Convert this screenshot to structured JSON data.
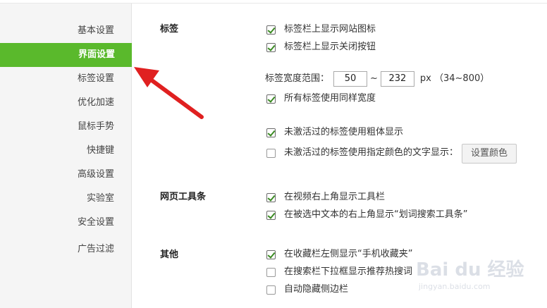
{
  "sidebar": {
    "items": [
      {
        "label": "基本设置"
      },
      {
        "label": "界面设置",
        "active": true
      },
      {
        "label": "标签设置"
      },
      {
        "label": "优化加速"
      },
      {
        "label": "鼠标手势"
      },
      {
        "label": "快捷键"
      },
      {
        "label": "高级设置"
      },
      {
        "label": "实验室"
      },
      {
        "label": "安全设置"
      },
      {
        "label": "广告过滤"
      }
    ]
  },
  "sections": {
    "tabs": {
      "title": "标签",
      "show_site_icon": {
        "label": "标签栏上显示网站图标",
        "checked": true
      },
      "show_close_button": {
        "label": "标签栏上显示关闭按钮",
        "checked": true
      },
      "width_range": {
        "label": "标签宽度范围：",
        "min": "50",
        "separator": "~",
        "max": "232",
        "unit": "px （34~800）"
      },
      "same_width": {
        "label": "所有标签使用同样宽度",
        "checked": true
      },
      "bold_inactive": {
        "label": "未激活过的标签使用粗体显示",
        "checked": true
      },
      "color_inactive": {
        "label": "未激活过的标签使用指定颜色的文字显示：",
        "checked": false
      },
      "set_color_button": "设置颜色"
    },
    "toolbar": {
      "title": "网页工具条",
      "video_toolbar": {
        "label": "在视频右上角显示工具栏",
        "checked": true
      },
      "selection_toolbar": {
        "label": "在被选中文本的右上角显示“划词搜索工具条”",
        "checked": true
      }
    },
    "other": {
      "title": "其他",
      "mobile_favorites": {
        "label": "在收藏栏左侧显示“手机收藏夹”",
        "checked": true
      },
      "search_suggestions": {
        "label": "在搜索栏下拉框显示推荐热搜词",
        "checked": false
      },
      "auto_hide_sidebar": {
        "label": "自动隐藏侧边栏",
        "checked": false
      }
    }
  },
  "watermark": {
    "main": "Bai du 经验",
    "sub": "jingyan.baidu.com"
  },
  "colors": {
    "accent": "#5ab92c",
    "arrow": "#e02020"
  }
}
